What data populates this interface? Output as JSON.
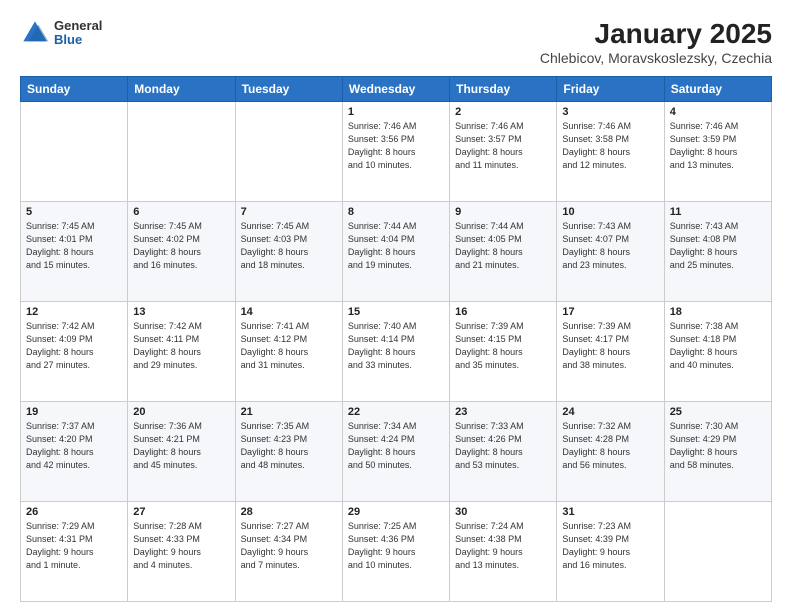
{
  "logo": {
    "general": "General",
    "blue": "Blue"
  },
  "header": {
    "title": "January 2025",
    "subtitle": "Chlebicov, Moravskoslezsky, Czechia"
  },
  "weekdays": [
    "Sunday",
    "Monday",
    "Tuesday",
    "Wednesday",
    "Thursday",
    "Friday",
    "Saturday"
  ],
  "weeks": [
    [
      {
        "day": "",
        "info": ""
      },
      {
        "day": "",
        "info": ""
      },
      {
        "day": "",
        "info": ""
      },
      {
        "day": "1",
        "info": "Sunrise: 7:46 AM\nSunset: 3:56 PM\nDaylight: 8 hours\nand 10 minutes."
      },
      {
        "day": "2",
        "info": "Sunrise: 7:46 AM\nSunset: 3:57 PM\nDaylight: 8 hours\nand 11 minutes."
      },
      {
        "day": "3",
        "info": "Sunrise: 7:46 AM\nSunset: 3:58 PM\nDaylight: 8 hours\nand 12 minutes."
      },
      {
        "day": "4",
        "info": "Sunrise: 7:46 AM\nSunset: 3:59 PM\nDaylight: 8 hours\nand 13 minutes."
      }
    ],
    [
      {
        "day": "5",
        "info": "Sunrise: 7:45 AM\nSunset: 4:01 PM\nDaylight: 8 hours\nand 15 minutes."
      },
      {
        "day": "6",
        "info": "Sunrise: 7:45 AM\nSunset: 4:02 PM\nDaylight: 8 hours\nand 16 minutes."
      },
      {
        "day": "7",
        "info": "Sunrise: 7:45 AM\nSunset: 4:03 PM\nDaylight: 8 hours\nand 18 minutes."
      },
      {
        "day": "8",
        "info": "Sunrise: 7:44 AM\nSunset: 4:04 PM\nDaylight: 8 hours\nand 19 minutes."
      },
      {
        "day": "9",
        "info": "Sunrise: 7:44 AM\nSunset: 4:05 PM\nDaylight: 8 hours\nand 21 minutes."
      },
      {
        "day": "10",
        "info": "Sunrise: 7:43 AM\nSunset: 4:07 PM\nDaylight: 8 hours\nand 23 minutes."
      },
      {
        "day": "11",
        "info": "Sunrise: 7:43 AM\nSunset: 4:08 PM\nDaylight: 8 hours\nand 25 minutes."
      }
    ],
    [
      {
        "day": "12",
        "info": "Sunrise: 7:42 AM\nSunset: 4:09 PM\nDaylight: 8 hours\nand 27 minutes."
      },
      {
        "day": "13",
        "info": "Sunrise: 7:42 AM\nSunset: 4:11 PM\nDaylight: 8 hours\nand 29 minutes."
      },
      {
        "day": "14",
        "info": "Sunrise: 7:41 AM\nSunset: 4:12 PM\nDaylight: 8 hours\nand 31 minutes."
      },
      {
        "day": "15",
        "info": "Sunrise: 7:40 AM\nSunset: 4:14 PM\nDaylight: 8 hours\nand 33 minutes."
      },
      {
        "day": "16",
        "info": "Sunrise: 7:39 AM\nSunset: 4:15 PM\nDaylight: 8 hours\nand 35 minutes."
      },
      {
        "day": "17",
        "info": "Sunrise: 7:39 AM\nSunset: 4:17 PM\nDaylight: 8 hours\nand 38 minutes."
      },
      {
        "day": "18",
        "info": "Sunrise: 7:38 AM\nSunset: 4:18 PM\nDaylight: 8 hours\nand 40 minutes."
      }
    ],
    [
      {
        "day": "19",
        "info": "Sunrise: 7:37 AM\nSunset: 4:20 PM\nDaylight: 8 hours\nand 42 minutes."
      },
      {
        "day": "20",
        "info": "Sunrise: 7:36 AM\nSunset: 4:21 PM\nDaylight: 8 hours\nand 45 minutes."
      },
      {
        "day": "21",
        "info": "Sunrise: 7:35 AM\nSunset: 4:23 PM\nDaylight: 8 hours\nand 48 minutes."
      },
      {
        "day": "22",
        "info": "Sunrise: 7:34 AM\nSunset: 4:24 PM\nDaylight: 8 hours\nand 50 minutes."
      },
      {
        "day": "23",
        "info": "Sunrise: 7:33 AM\nSunset: 4:26 PM\nDaylight: 8 hours\nand 53 minutes."
      },
      {
        "day": "24",
        "info": "Sunrise: 7:32 AM\nSunset: 4:28 PM\nDaylight: 8 hours\nand 56 minutes."
      },
      {
        "day": "25",
        "info": "Sunrise: 7:30 AM\nSunset: 4:29 PM\nDaylight: 8 hours\nand 58 minutes."
      }
    ],
    [
      {
        "day": "26",
        "info": "Sunrise: 7:29 AM\nSunset: 4:31 PM\nDaylight: 9 hours\nand 1 minute."
      },
      {
        "day": "27",
        "info": "Sunrise: 7:28 AM\nSunset: 4:33 PM\nDaylight: 9 hours\nand 4 minutes."
      },
      {
        "day": "28",
        "info": "Sunrise: 7:27 AM\nSunset: 4:34 PM\nDaylight: 9 hours\nand 7 minutes."
      },
      {
        "day": "29",
        "info": "Sunrise: 7:25 AM\nSunset: 4:36 PM\nDaylight: 9 hours\nand 10 minutes."
      },
      {
        "day": "30",
        "info": "Sunrise: 7:24 AM\nSunset: 4:38 PM\nDaylight: 9 hours\nand 13 minutes."
      },
      {
        "day": "31",
        "info": "Sunrise: 7:23 AM\nSunset: 4:39 PM\nDaylight: 9 hours\nand 16 minutes."
      },
      {
        "day": "",
        "info": ""
      }
    ]
  ]
}
